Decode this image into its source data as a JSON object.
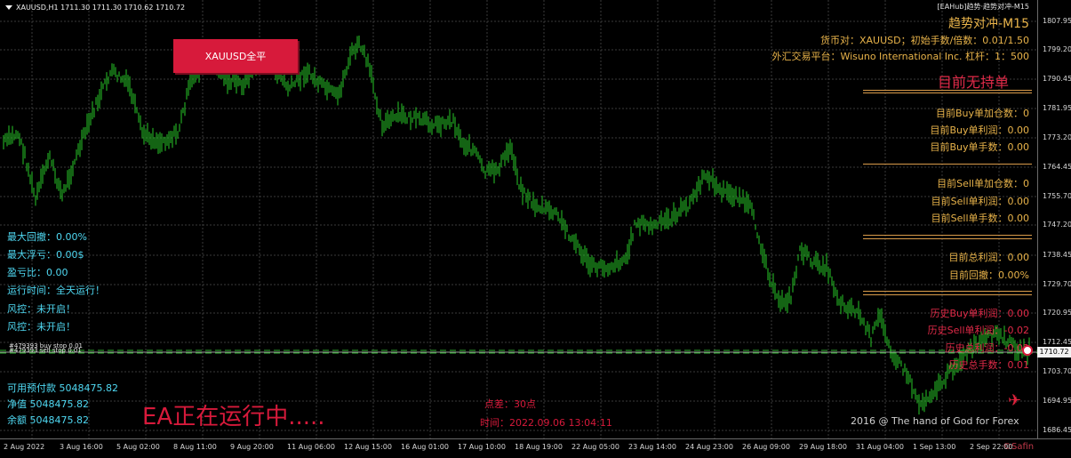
{
  "header": {
    "symbol_line": "XAUUSD,H1  1711.30 1711.30 1710.62 1710.72",
    "ea_name": "[EAHub]趋势·趋势对冲-M15",
    "ea_title": "趋势对冲-M15",
    "currency_line": "货币对：XAUUSD；初始手数/倍数：0.01/1.50",
    "platform_line": "外汇交易平台：Wisuno International Inc. 杠杆：1：500"
  },
  "buttons": {
    "close_all": "XAUUSD全平"
  },
  "right_panel": {
    "no_position": "目前无持单",
    "buy_add_count": "目前Buy单加仓数：0",
    "buy_profit": "目前Buy单利润：0.00",
    "buy_lots": "目前Buy单手数：0.00",
    "sell_add_count": "目前Sell单加仓数：0",
    "sell_profit": "目前Sell单利润：0.00",
    "sell_lots": "目前Sell单手数：0.00",
    "total_profit": "目前总利润：0.00",
    "drawdown": "目前回撤：0.00%",
    "hist_buy_profit": "历史Buy单利润：0.00",
    "hist_sell_profit": "历史Sell单利润：-0.02",
    "hist_total_profit": "历史总利润：-0.02",
    "hist_total_lots": "历史总手数：0.01"
  },
  "left_panel": {
    "max_drawdown": "最大回撤：0.00%",
    "max_float_loss": "最大浮亏：0.00$",
    "pl_ratio": "盈亏比：0.00",
    "run_time": "运行时间：全天运行！",
    "risk1": "风控：未开启！",
    "risk2": "风控：未开启！",
    "free_margin": "可用预付款 5048475.82",
    "equity": "净值 5048475.82",
    "balance": "余额 5048475.82"
  },
  "orders": {
    "line1": "#479393 buy stop 0.01",
    "line2": "#479393 sell stop 0.01"
  },
  "status": {
    "running": "EA正在运行中.....",
    "spread": "点差：30点",
    "time": "时间：2022.09.06 13:04:11",
    "credit": "2016 @ The hand of God for Forex",
    "watermark": "©Safin"
  },
  "current_price": "1710.72",
  "price_axis": [
    "1807.95",
    "1799.20",
    "1790.45",
    "1781.95",
    "1773.20",
    "1764.45",
    "1755.70",
    "1747.20",
    "1738.45",
    "1729.70",
    "1720.95",
    "1712.45",
    "1703.70",
    "1694.95",
    "1686.45"
  ],
  "time_axis": [
    "2 Aug 2022",
    "3 Aug 16:00",
    "5 Aug 02:00",
    "8 Aug 11:00",
    "9 Aug 20:00",
    "11 Aug 06:00",
    "12 Aug 15:00",
    "16 Aug 01:00",
    "17 Aug 10:00",
    "18 Aug 19:00",
    "22 Aug 05:00",
    "23 Aug 14:00",
    "24 Aug 23:00",
    "26 Aug 09:00",
    "29 Aug 18:00",
    "31 Aug 04:00",
    "1 Sep 13:00",
    "2 Sep 22:00"
  ],
  "colors": {
    "candle": "#29c829",
    "grid": "#3a3a3a",
    "accent_red": "#d71a3b",
    "gold": "#e8b34a",
    "cyan": "#4fd8f2",
    "order_line": "#2fb52f"
  }
}
